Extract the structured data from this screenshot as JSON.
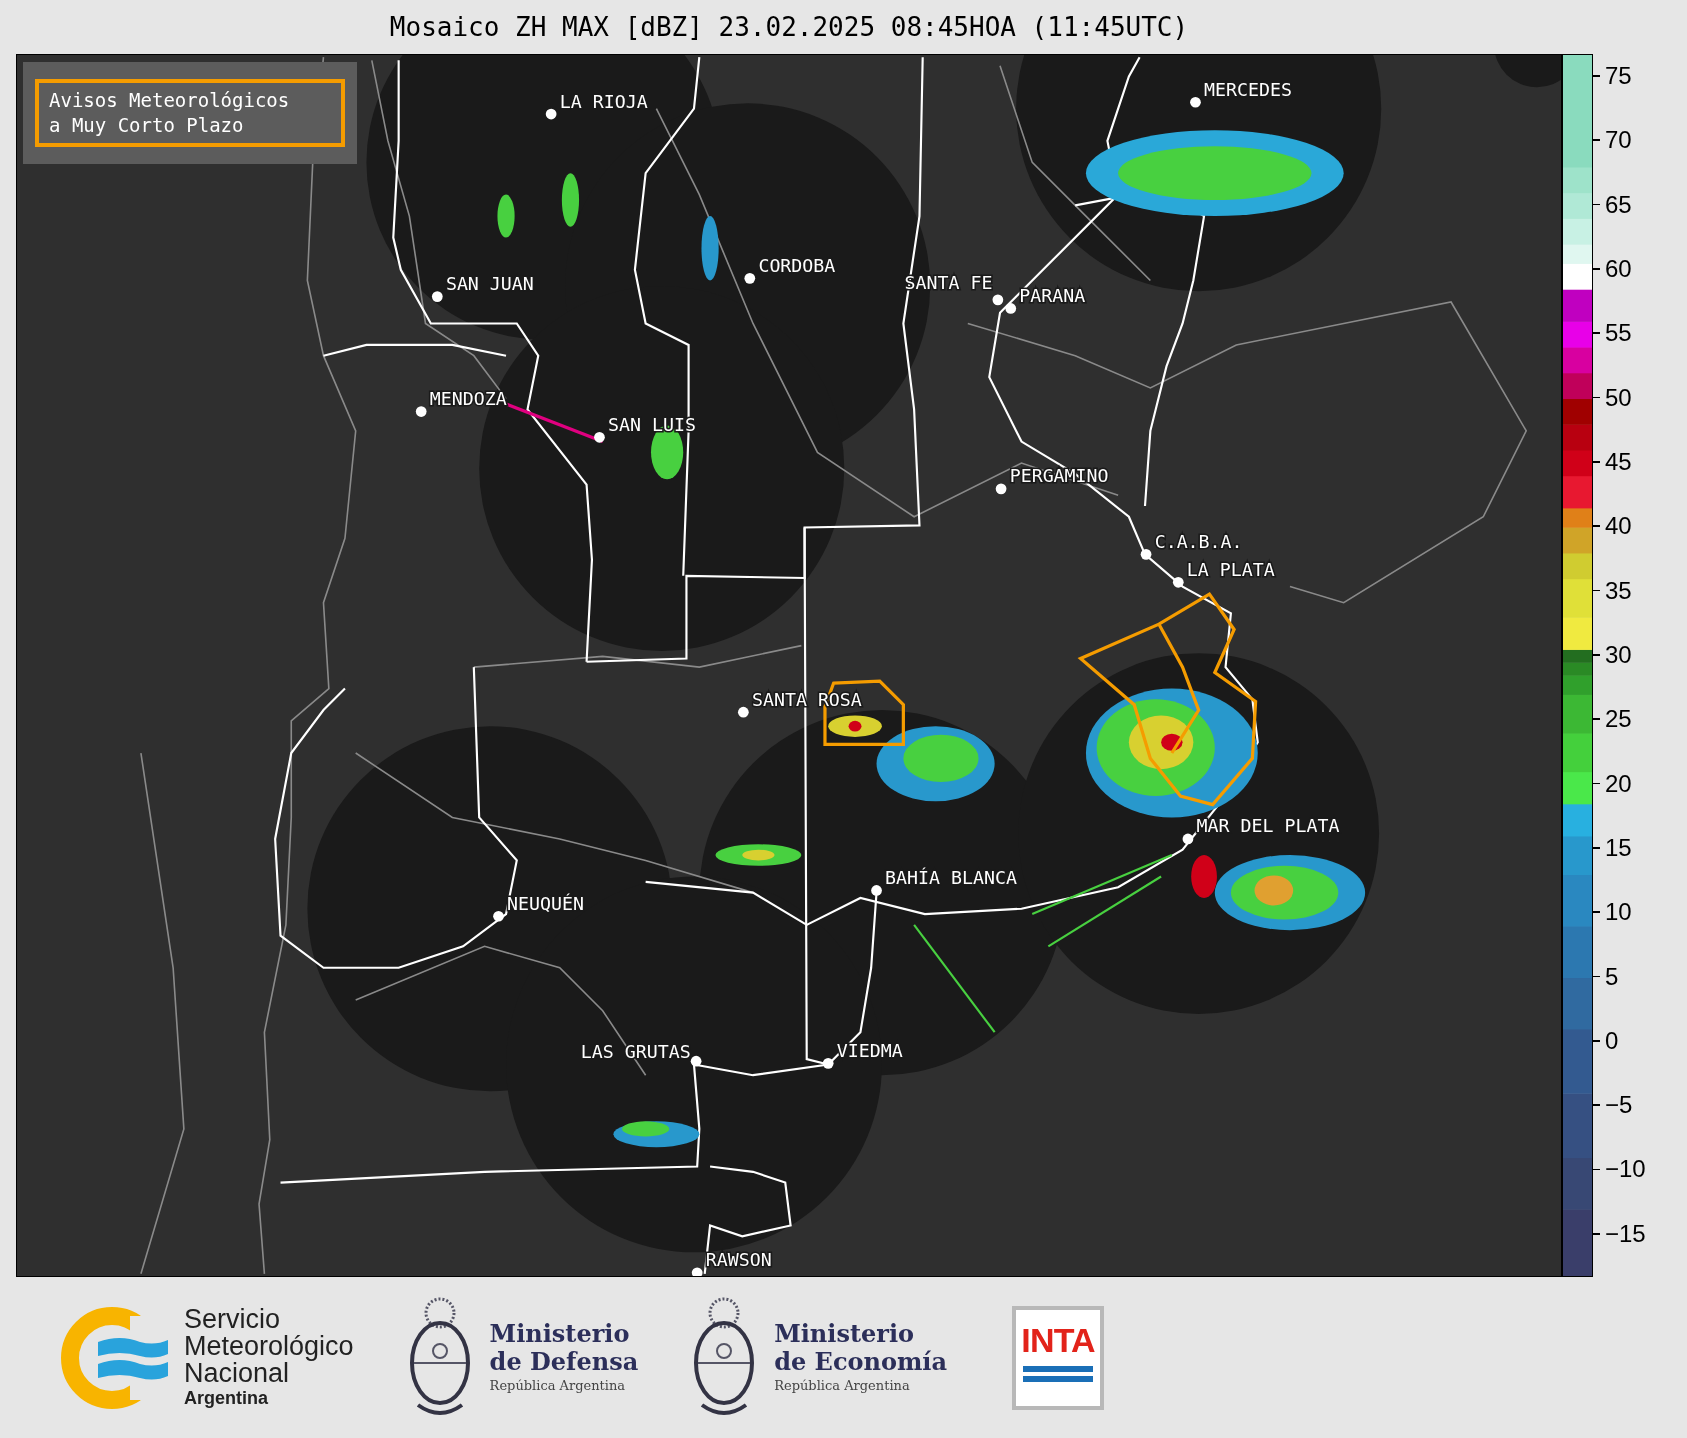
{
  "title": "Mosaico ZH MAX [dBZ] 23.02.2025 08:45HOA (11:45UTC)",
  "legend": {
    "label": "Avisos Meteorológicos\na Muy Corto Plazo"
  },
  "cities": [
    {
      "name": "LA RIOJA"
    },
    {
      "name": "SAN JUAN"
    },
    {
      "name": "CORDOBA"
    },
    {
      "name": "SANTA FE"
    },
    {
      "name": "PARANA"
    },
    {
      "name": "MENDOZA"
    },
    {
      "name": "SAN LUIS"
    },
    {
      "name": "MERCEDES"
    },
    {
      "name": "PERGAMINO"
    },
    {
      "name": "C.A.B.A."
    },
    {
      "name": "LA PLATA"
    },
    {
      "name": "SANTA ROSA"
    },
    {
      "name": "MAR DEL PLATA"
    },
    {
      "name": "BAHÍA BLANCA"
    },
    {
      "name": "NEUQUÉN"
    },
    {
      "name": "LAS GRUTAS"
    },
    {
      "name": "VIEDMA"
    },
    {
      "name": "RAWSON"
    }
  ],
  "colorbar": {
    "ticks": [
      "75",
      "70",
      "65",
      "60",
      "55",
      "50",
      "45",
      "40",
      "35",
      "30",
      "25",
      "20",
      "15",
      "10",
      "5",
      "0",
      "−5",
      "−10",
      "−15"
    ]
  },
  "logos": [
    {
      "kind": "smn",
      "lines": [
        "Servicio",
        "Meteorológico",
        "Nacional"
      ],
      "subtitle": "Argentina"
    },
    {
      "kind": "ministry",
      "lines": [
        "Ministerio",
        "de Defensa"
      ],
      "subtitle": "República Argentina"
    },
    {
      "kind": "ministry",
      "lines": [
        "Ministerio",
        "de Economía"
      ],
      "subtitle": "República Argentina"
    },
    {
      "kind": "inta",
      "lines": [
        "INTA"
      ]
    }
  ]
}
